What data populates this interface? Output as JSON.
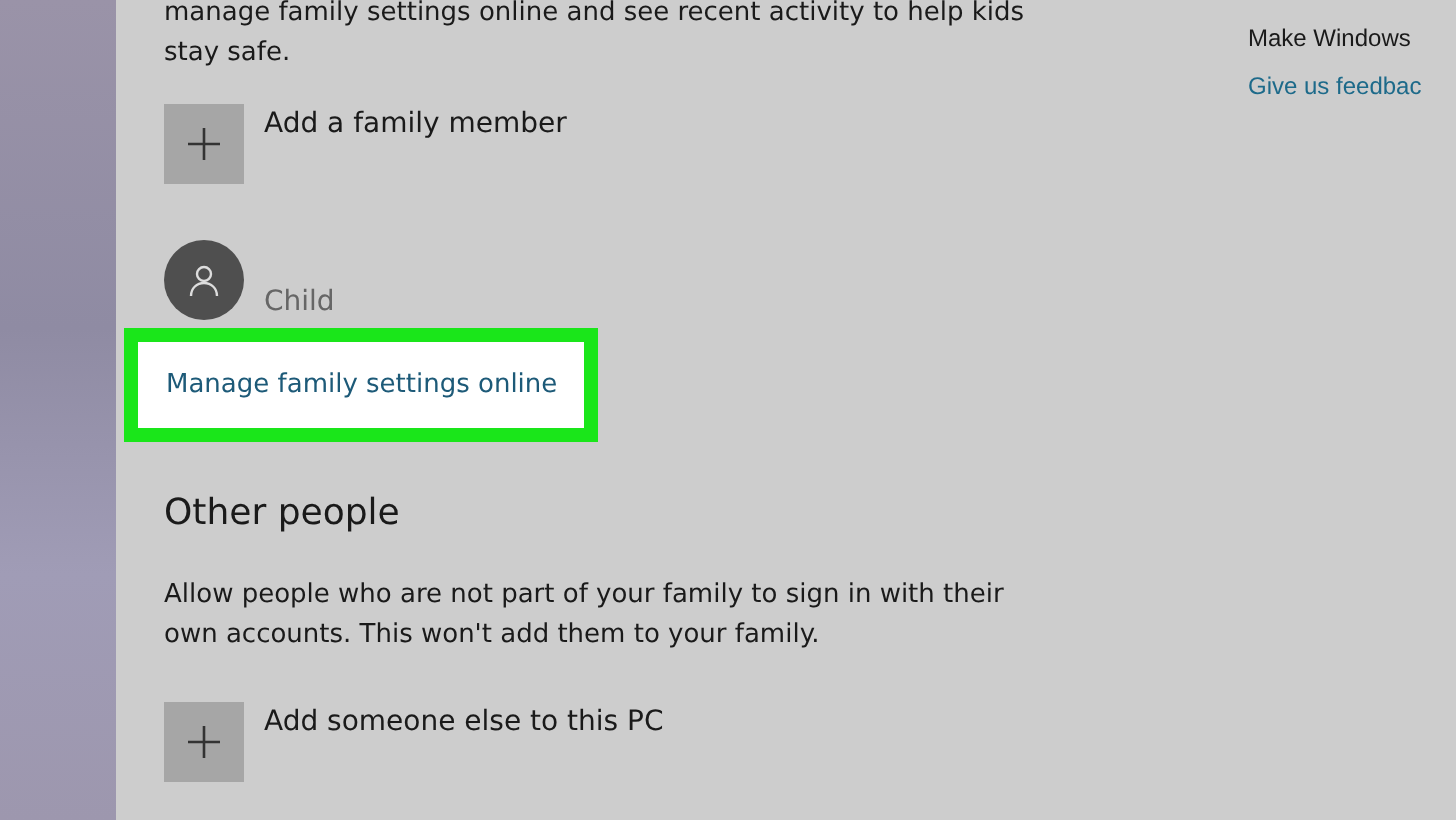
{
  "family": {
    "intro_lines": [
      "manage family settings online and see recent activity to help kids",
      "stay safe."
    ],
    "add_member": {
      "label": "Add a family member"
    },
    "members": [
      {
        "name": "Child"
      }
    ],
    "manage_link": {
      "label": "Manage family settings online",
      "highlighted": true
    }
  },
  "other_people": {
    "heading": "Other people",
    "description_lines": [
      "Allow people who are not part of your family to sign in with their",
      "own accounts. This won't add them to your family."
    ],
    "add_someone": {
      "label": "Add someone else to this PC"
    }
  },
  "side": {
    "text": "Make Windows",
    "link": "Give us feedbac"
  }
}
